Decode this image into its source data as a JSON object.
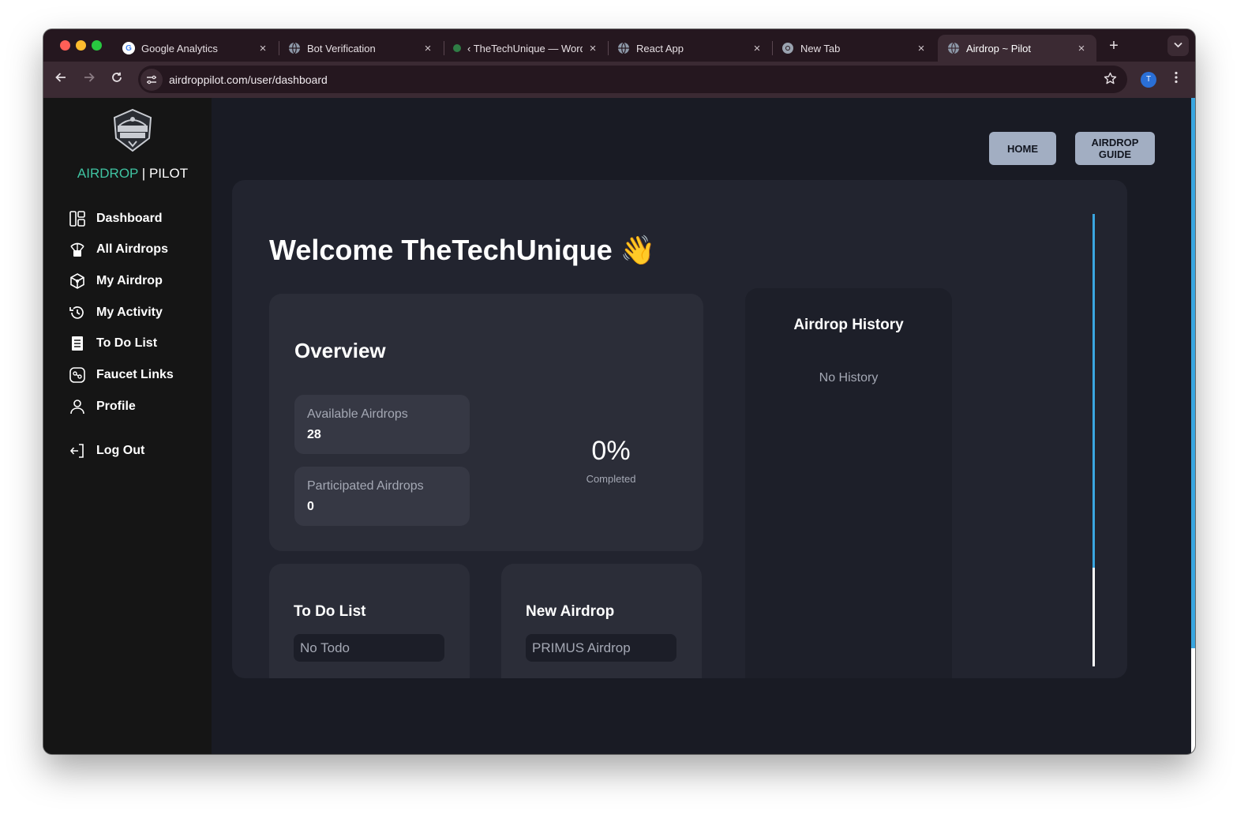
{
  "browser": {
    "tabs": [
      {
        "title": "Google Analytics",
        "favicon": "google-g"
      },
      {
        "title": "Bot Verification",
        "favicon": "globe"
      },
      {
        "title": "‹ TheTechUnique — Word",
        "favicon": "wp"
      },
      {
        "title": "React App",
        "favicon": "globe"
      },
      {
        "title": "New Tab",
        "favicon": "chrome"
      },
      {
        "title": "Airdrop ~ Pilot",
        "favicon": "globe",
        "active": true
      }
    ],
    "close_glyph": "×",
    "new_tab_glyph": "+",
    "url": "airdroppilot.com/user/dashboard",
    "profile_initial": "T"
  },
  "sidebar": {
    "brand_accent": "AIRDROP",
    "brand_sep": " | ",
    "brand_rest": "PILOT",
    "items": [
      {
        "label": "Dashboard",
        "icon": "dashboard-icon"
      },
      {
        "label": "All Airdrops",
        "icon": "parachute-box-icon"
      },
      {
        "label": "My Airdrop",
        "icon": "package-icon"
      },
      {
        "label": "My Activity",
        "icon": "history-icon"
      },
      {
        "label": "To Do List",
        "icon": "list-icon"
      },
      {
        "label": "Faucet Links",
        "icon": "faucet-icon"
      },
      {
        "label": "Profile",
        "icon": "user-icon"
      },
      {
        "label": "Log Out",
        "icon": "logout-icon"
      }
    ]
  },
  "header": {
    "home_label": "HOME",
    "guide_label_line1": "AIRDROP",
    "guide_label_line2": "GUIDE"
  },
  "main": {
    "welcome": "Welcome TheTechUnique 👋",
    "overview": {
      "title": "Overview",
      "available_label": "Available Airdrops",
      "available_value": "28",
      "participated_label": "Participated Airdrops",
      "participated_value": "0",
      "percent": "0%",
      "percent_label": "Completed"
    },
    "todo": {
      "title": "To Do List",
      "first_item": "No Todo"
    },
    "new_airdrop": {
      "title": "New Airdrop",
      "first_item": "PRIMUS Airdrop"
    },
    "history": {
      "title": "Airdrop History",
      "empty": "No History"
    }
  },
  "colors": {
    "accent": "#3fc3a1",
    "button_bg": "#a2aec2",
    "scroll_thumb": "#3aa6e0"
  }
}
